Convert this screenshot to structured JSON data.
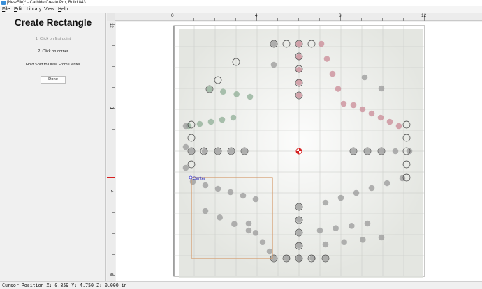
{
  "window": {
    "title": "[NewFile]* - Carbide Create Pro, Build 843"
  },
  "menu": [
    {
      "key": "F",
      "rest": "ile"
    },
    {
      "key": "E",
      "rest": "dit"
    },
    {
      "key": "",
      "rest": "Library"
    },
    {
      "key": "",
      "rest": "View"
    },
    {
      "key": "H",
      "rest": "elp"
    }
  ],
  "panel": {
    "heading": "Create Rectangle",
    "step1": "1. Click on first point",
    "step2": "2. Click on corner",
    "hint": "Hold Shift to Draw From Center",
    "done_label": "Done"
  },
  "ruler": {
    "h_labels": [
      "0",
      "4",
      "8",
      "12"
    ],
    "v_labels": [
      "12",
      "8",
      "4",
      "0"
    ]
  },
  "canvas": {
    "center_label": "Center"
  },
  "status": {
    "text": "Cursor Position X: 0.859 Y: 4.750 Z: 0.000 in"
  },
  "colors": {
    "rectangle": "#d49a6a",
    "origin_marker": "#d62020",
    "ruler_marker": "#d62020",
    "hole_gray": "#9a9a9a",
    "hole_pink": "#c98a96",
    "hole_green": "#8fae96"
  }
}
